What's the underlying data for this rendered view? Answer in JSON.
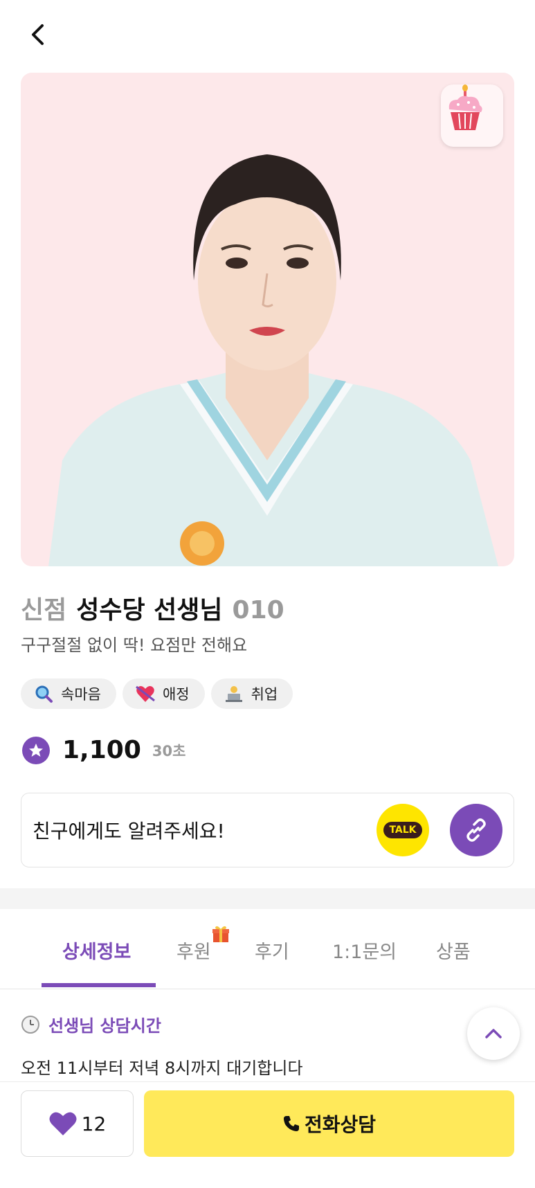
{
  "header": {
    "back_icon": "chevron-left-icon"
  },
  "profile": {
    "image_alt": "profile-photo",
    "badge_icon": "cupcake-icon",
    "new_tag": "신점",
    "name": "성수당 선생님",
    "code": "010",
    "subtitle": "구구절절 없이 딱! 요점만 전해요"
  },
  "chips": [
    {
      "icon": "magnifier-icon",
      "label": "속마음"
    },
    {
      "icon": "heart-arrow-icon",
      "label": "애정"
    },
    {
      "icon": "laptop-work-icon",
      "label": "취업"
    }
  ],
  "rating": {
    "price": "1,100",
    "unit": "30초"
  },
  "share": {
    "text": "친구에게도 알려주세요!",
    "talk_label": "TALK"
  },
  "tabs": [
    {
      "label": "상세정보",
      "active": true
    },
    {
      "label": "후원",
      "active": false
    },
    {
      "label": "후기",
      "active": false
    },
    {
      "label": "1:1문의",
      "active": false
    },
    {
      "label": "상품",
      "active": false
    }
  ],
  "hours": {
    "title": "선생님 상담시간",
    "text": "오전 11시부터 저녁 8시까지 대기합니다"
  },
  "bottom": {
    "like_count": "12",
    "call_label": "전화상담"
  },
  "colors": {
    "accent": "#7b4bb7",
    "call_bg": "#ffe95a",
    "kakao": "#fee500",
    "hero_bg": "#fde8ea"
  }
}
